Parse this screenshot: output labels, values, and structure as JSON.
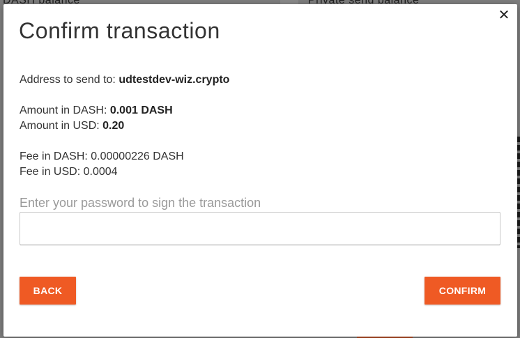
{
  "background": {
    "left_label": "DASH balance",
    "right_label": "Private send balance"
  },
  "modal": {
    "title": "Confirm transaction",
    "close_icon": "close-icon",
    "address_label": "Address to send to: ",
    "address_value": "udtestdev-wiz.crypto",
    "amount_dash_label": "Amount in DASH: ",
    "amount_dash_value": "0.001 DASH",
    "amount_usd_label": "Amount in USD: ",
    "amount_usd_value": "0.20",
    "fee_dash_label": "Fee in DASH: ",
    "fee_dash_value": "0.00000226 DASH",
    "fee_usd_label": "Fee in USD: ",
    "fee_usd_value": "0.0004",
    "password_label": "Enter your password to sign the transaction",
    "password_value": "",
    "back_label": "BACK",
    "confirm_label": "CONFIRM"
  },
  "colors": {
    "accent": "#ef5a24",
    "text": "#333333",
    "muted": "#9a9a9a",
    "overlay": "#7e7e7e"
  }
}
